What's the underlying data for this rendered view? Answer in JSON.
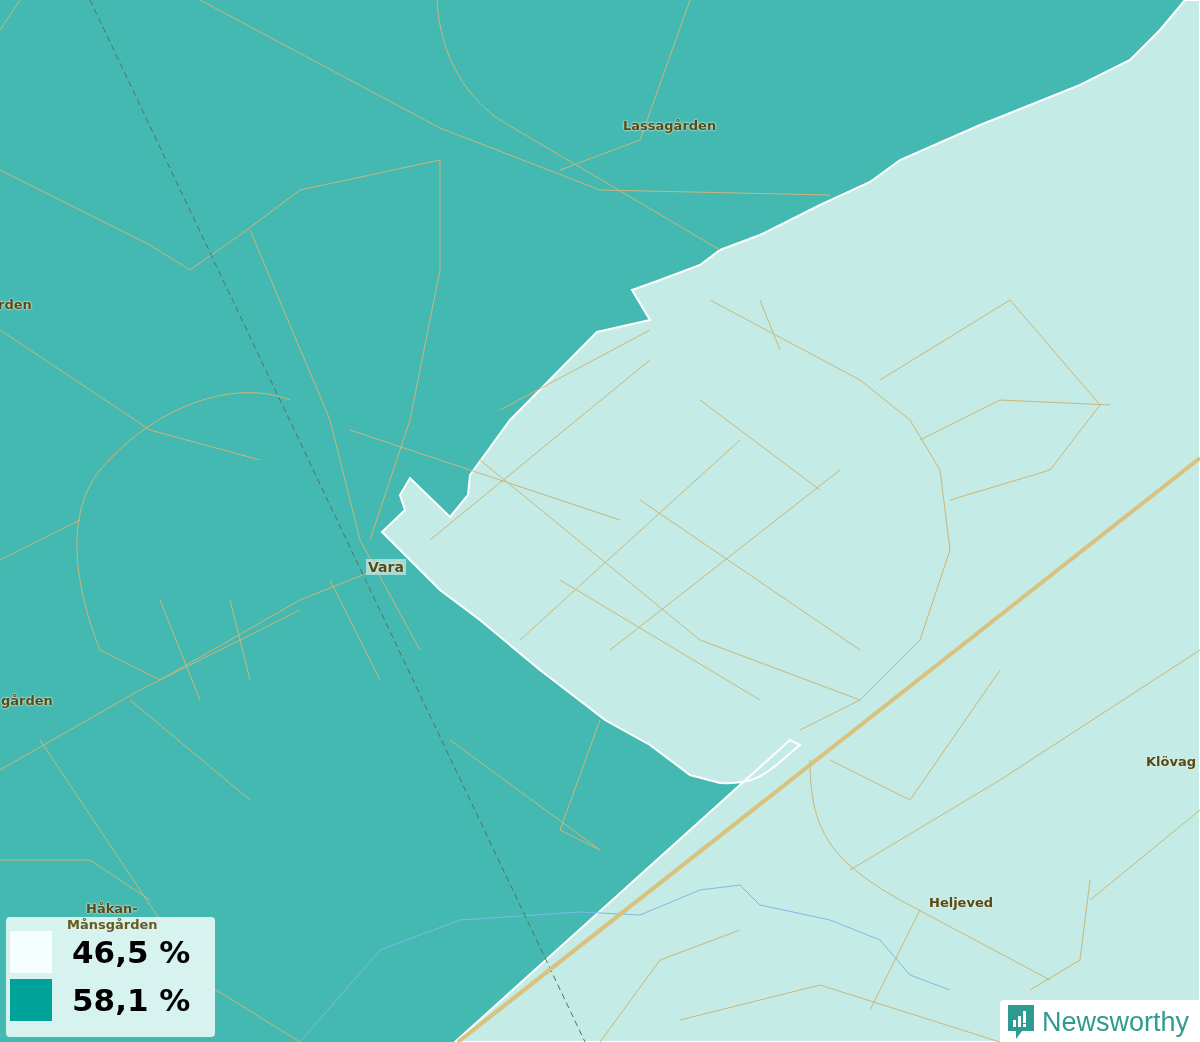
{
  "map": {
    "places": [
      {
        "name": "Lassagården"
      },
      {
        "name": "rden"
      },
      {
        "name": "Vara"
      },
      {
        "name": "gården"
      },
      {
        "name": "Håkan-"
      },
      {
        "name": "Månsgården"
      },
      {
        "name": "Klövag"
      },
      {
        "name": "Heljeved"
      }
    ]
  },
  "legend": {
    "items": [
      {
        "label": "46,5 %",
        "color": "#f5fffd"
      },
      {
        "label": "58,1 %",
        "color": "#00a39a"
      }
    ]
  },
  "logo": {
    "text": "Newsworthy"
  }
}
